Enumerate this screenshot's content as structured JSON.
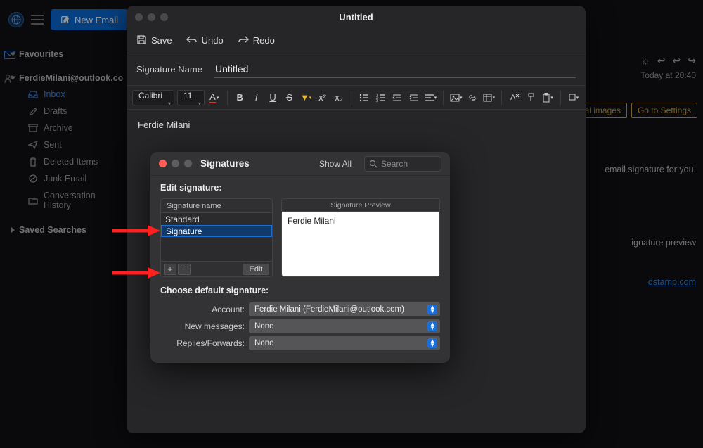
{
  "topbar": {
    "new_email_label": "New Email"
  },
  "sidebar": {
    "favourites_label": "Favourites",
    "account_label": "FerdieMilani@outlook.co",
    "saved_searches_label": "Saved Searches",
    "folders": {
      "inbox": "Inbox",
      "drafts": "Drafts",
      "archive": "Archive",
      "sent": "Sent",
      "deleted": "Deleted Items",
      "junk": "Junk Email",
      "conversation_history": "Conversation History"
    }
  },
  "bg_right": {
    "timestamp": "Today at 20:40",
    "download_btn": "ad external images",
    "settings_btn": "Go to Settings",
    "frag1": "email signature for you.",
    "frag2": "ignature preview",
    "link_frag": "dstamp.com"
  },
  "editor": {
    "title": "Untitled",
    "save_label": "Save",
    "undo_label": "Undo",
    "redo_label": "Redo",
    "sig_name_label": "Signature Name",
    "sig_name_value": "Untitled",
    "font_name": "Calibri",
    "font_size": "11",
    "body_text": "Ferdie Milani"
  },
  "signatures_modal": {
    "title": "Signatures",
    "show_all_label": "Show All",
    "search_placeholder": "Search",
    "edit_label": "Edit signature:",
    "list_header": "Signature name",
    "signatures": [
      "Standard",
      "Signature"
    ],
    "editing_value": "Signature",
    "edit_btn_label": "Edit",
    "preview_header": "Signature Preview",
    "preview_body": "Ferdie Milani",
    "default_label": "Choose default signature:",
    "account_label": "Account:",
    "account_value": "Ferdie Milani (FerdieMilani@outlook.com)",
    "new_messages_label": "New messages:",
    "new_messages_value": "None",
    "replies_label": "Replies/Forwards:",
    "replies_value": "None"
  }
}
